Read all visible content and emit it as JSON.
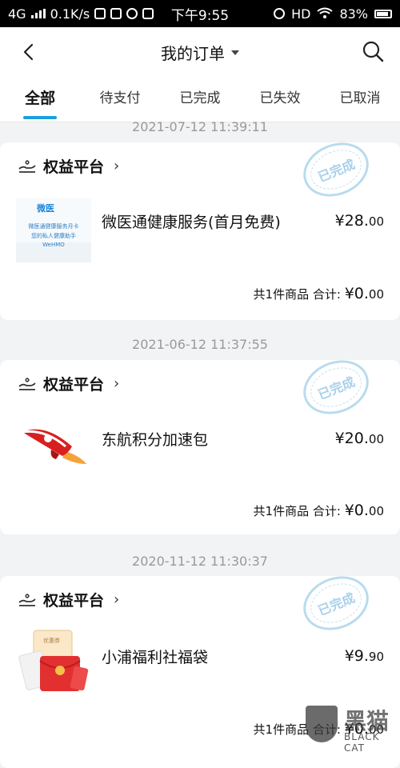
{
  "status_bar": {
    "network": "4G",
    "speed": "0.1K/s",
    "time": "下午9:55",
    "hd": "HD",
    "battery": "83%"
  },
  "header": {
    "title": "我的订单",
    "back_icon": "back-arrow-icon",
    "search_icon": "search-icon"
  },
  "tabs": [
    "全部",
    "待支付",
    "已完成",
    "已失效",
    "已取消"
  ],
  "orders": [
    {
      "timestamp": "2021-07-12 11:39:11",
      "store": "权益平台",
      "status_stamp": "已完成",
      "item_name": "微医通健康服务(首月免费)",
      "price_main": "¥28.",
      "price_cents": "00",
      "summary_label": "共1件商品 合计:",
      "total_main": "¥0.",
      "total_cents": "00",
      "thumb_text": {
        "brand": "微医",
        "line1": "微医通健康服务月卡",
        "line2": "您的私人健康助手",
        "line3": "WeHMO"
      }
    },
    {
      "timestamp": "2021-06-12 11:37:55",
      "store": "权益平台",
      "status_stamp": "已完成",
      "item_name": "东航积分加速包",
      "price_main": "¥20.",
      "price_cents": "00",
      "summary_label": "共1件商品 合计:",
      "total_main": "¥0.",
      "total_cents": "00"
    },
    {
      "timestamp": "2020-11-12 11:30:37",
      "store": "权益平台",
      "status_stamp": "已完成",
      "item_name": "小浦福利社福袋",
      "price_main": "¥9.",
      "price_cents": "90",
      "summary_label": "共1件商品 合计:",
      "total_main": "¥0.",
      "total_cents": "00",
      "thumb_text": {
        "card": "优惠券"
      }
    }
  ],
  "watermark": {
    "text": "黑猫",
    "sub": "BLACK CAT"
  },
  "colors": {
    "accent": "#1a9fe0",
    "stamp": "#a9d1ea",
    "background": "#f2f3f5"
  }
}
